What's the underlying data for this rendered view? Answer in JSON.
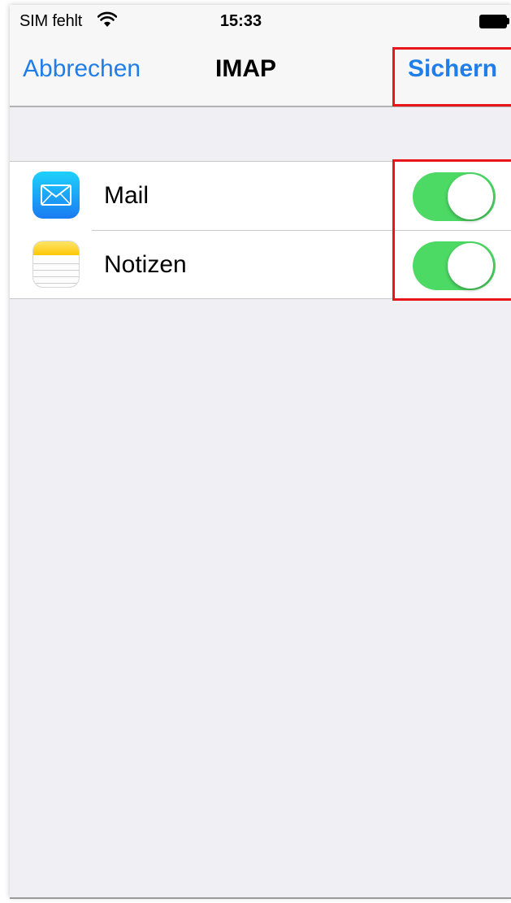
{
  "status_bar": {
    "carrier": "SIM fehlt",
    "time": "15:33",
    "wifi_icon": "wifi-icon",
    "battery_icon": "battery-icon"
  },
  "nav_bar": {
    "cancel_label": "Abbrechen",
    "title": "IMAP",
    "save_label": "Sichern"
  },
  "settings_rows": [
    {
      "label": "Mail",
      "icon": "mail-app-icon",
      "enabled": true
    },
    {
      "label": "Notizen",
      "icon": "notes-app-icon",
      "enabled": true
    }
  ],
  "colors": {
    "accent": "#1f7ee8",
    "toggle_on": "#4cd964",
    "highlight": "#e8161b",
    "background": "#efeff4"
  }
}
